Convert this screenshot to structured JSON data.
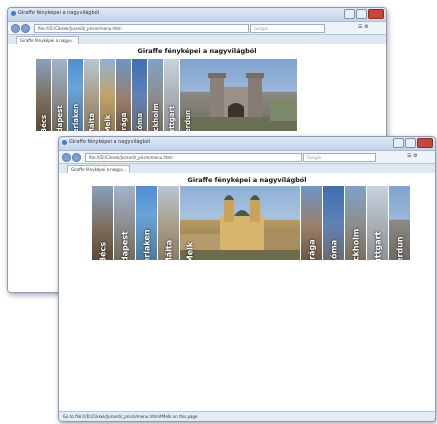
{
  "back_window": {
    "title": "Giraffe fényképei a nagyvilágból",
    "url": "file:///D:/Cikkek/Jurandi/_prism/menu.html",
    "search_placeholder": "Google",
    "tab": "Giraffe fényképei a nagyv...",
    "heading": "Giraffe fényképei a nagyvilágból",
    "slices": [
      "Bécs",
      "Budapest",
      "Interlaken",
      "Málta",
      "Melk",
      "Prága",
      "Róma",
      "Stockholm",
      "Stuttgart",
      "Verdun"
    ],
    "expanded": "Verdun"
  },
  "front_window": {
    "title": "Giraffe fényképei a nagyvilágból",
    "url": "file:///D:/Cikkek/Jurandi/_prism/menu.html",
    "search_placeholder": "Google",
    "tab": "Giraffe fényképei a nagyv...",
    "heading": "Giraffe fényképei a nagyvilágból",
    "slices": [
      "Bécs",
      "Budapest",
      "Interlaken",
      "Málta",
      "Melk",
      "Prága",
      "Róma",
      "Stockholm",
      "Stuttgart",
      "Verdun"
    ],
    "expanded": "Melk",
    "status": "Go to file:///D:/Cikkek/Jurandi/_prism/menu.html#Melk on this page"
  },
  "colors": {
    "accent": "#3b7fd1",
    "chrome": "#dfe9f5"
  }
}
